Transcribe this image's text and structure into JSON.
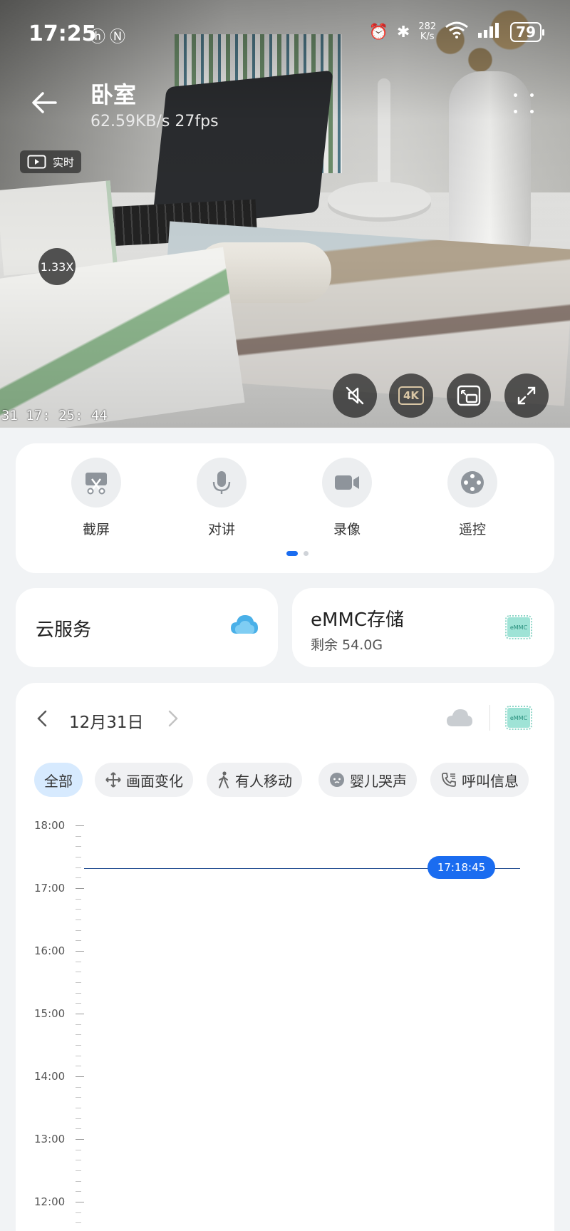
{
  "status_bar": {
    "time": "17:25",
    "left_icons": [
      "hd-icon",
      "nfc-icon"
    ],
    "net_speed_value": "282",
    "net_speed_unit": "K/s",
    "wifi_label": "6",
    "battery": "79"
  },
  "header": {
    "title": "卧室",
    "subtitle": "62.59KB/s   27fps"
  },
  "video": {
    "live_badge": "实时",
    "zoom": "1.33X",
    "osd_time": "31  17: 25: 44",
    "controls": [
      "mute-icon",
      "4k-icon",
      "pip-icon",
      "fullscreen-icon"
    ],
    "quality_label": "4K"
  },
  "actions": [
    {
      "label": "截屏",
      "icon": "screenshot-icon"
    },
    {
      "label": "对讲",
      "icon": "microphone-icon"
    },
    {
      "label": "录像",
      "icon": "video-record-icon"
    },
    {
      "label": "遥控",
      "icon": "remote-control-icon"
    }
  ],
  "pager": {
    "pages": 2,
    "active": 0
  },
  "cloud_service": {
    "label": "云服务"
  },
  "storage": {
    "label": "eMMC存储",
    "remaining": "剩余 54.0G",
    "chip_text": "eMMC"
  },
  "timeline": {
    "date": "12月31日",
    "filters": [
      {
        "label": "全部",
        "active": true
      },
      {
        "label": "画面变化",
        "icon": "move-icon"
      },
      {
        "label": "有人移动",
        "icon": "walking-person-icon"
      },
      {
        "label": "婴儿哭声",
        "icon": "baby-icon"
      },
      {
        "label": "呼叫信息",
        "icon": "phone-call-icon"
      }
    ],
    "hours": [
      "18:00",
      "17:00",
      "16:00",
      "15:00",
      "14:00",
      "13:00",
      "12:00"
    ],
    "current_marker": "17:18:45"
  },
  "colors": {
    "accent": "#1a6cf0",
    "active_chip": "#d7eafe",
    "cloud": "#4ab0e8",
    "emmc": "#9fe3d6"
  }
}
